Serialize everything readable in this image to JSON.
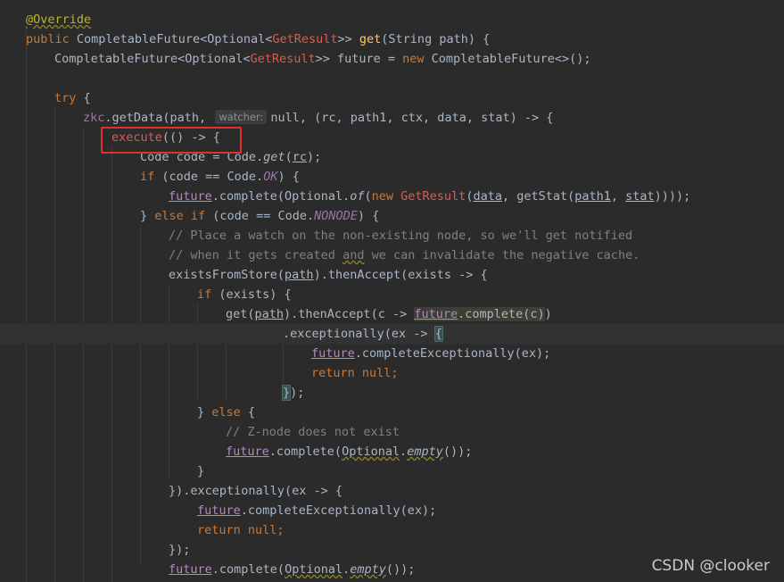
{
  "editor": {
    "hint_label": "watcher:",
    "lines": {
      "l1": {
        "ann": "@Override"
      },
      "l2": {
        "a": "public",
        "b": " CompletableFuture<Optional<",
        "c": "GetResult",
        ">": ">> ",
        "d": "get",
        "e": "(String path) {"
      },
      "l3": {
        "a": "CompletableFuture<Optional<",
        "b": "GetResult",
        "c": ">> future = ",
        "d": "new",
        "e": " CompletableFuture<>();"
      },
      "l5": {
        "a": "try",
        "b": " {"
      },
      "l6": {
        "a": "zkc",
        "b": ".getData(path, ",
        "c": "null, (rc, path1, ctx, data, stat) -> ",
        "d": "{"
      },
      "l7": {
        "a": "execute",
        "b": "(() -> {"
      },
      "l8": {
        "a": "Code code = Code.",
        "b": "get",
        "c": "(",
        "d": "rc",
        "e": ");"
      },
      "l9": {
        "a": "if",
        "b": " (code == Code.",
        "c": "OK",
        "d": ") {"
      },
      "l10": {
        "a": "future",
        "b": ".complete(Optional.",
        "c": "of",
        "d": "(",
        "e": "new",
        "f": " ",
        "g": "GetResult",
        "h": "(",
        "i": "data",
        "j": ", getStat(",
        "k": "path1",
        ",": ", ",
        "l": "stat",
        "m": "))));"
      },
      "l11": {
        "a": "} ",
        "b": "else if",
        "c": " (code == Code.",
        "d": "NONODE",
        "e": ") {"
      },
      "l12": {
        "a": "// Place a watch on the non-existing node, so we'll get notified"
      },
      "l13": {
        "a": "// when it gets created ",
        "b": "and",
        "c": " we can invalidate the negative cache."
      },
      "l14": {
        "a": "existsFromStore(",
        "b": "path",
        "c": ").thenAccept(exists -> {"
      },
      "l15": {
        "a": "if",
        "b": " (exists) {"
      },
      "l16": {
        "a": "get(",
        "b": "path",
        "c": ").thenAccept(c -> ",
        "d": "future",
        "e": ".complete(c)",
        "f": ")"
      },
      "l17": {
        "a": ".exceptionally(ex -> ",
        "b": "{"
      },
      "l18": {
        "a": "future",
        "b": ".completeExceptionally(ex);"
      },
      "l19": {
        "a": "return",
        "b": " null;"
      },
      "l20": {
        "a": "}",
        "b": ");"
      },
      "l21": {
        "a": "} ",
        "b": "else",
        "c": " {"
      },
      "l22": {
        "a": "// Z-node does not exist"
      },
      "l23": {
        "a": "future",
        "b": ".complete(",
        "c": "Optional",
        "d": ".",
        "e": "empty",
        "f": "());"
      },
      "l24": {
        "a": "}"
      },
      "l25": {
        "a": "}).exceptionally(ex -> {"
      },
      "l26": {
        "a": "future",
        "b": ".completeExceptionally(ex);"
      },
      "l27": {
        "a": "return",
        "b": " null;"
      },
      "l28": {
        "a": "});"
      },
      "l29": {
        "a": "future",
        "b": ".complete(",
        "c": "Optional",
        ".": ".",
        "e": "empty",
        "f": "());"
      }
    }
  },
  "watermark": "CSDN @clooker",
  "colors": {
    "background": "#2b2b2b",
    "keyword": "#cc7832",
    "function": "#ffc66d",
    "comment": "#808080",
    "field": "#9876aa",
    "annotation": "#bbb529",
    "error": "#e05a4f",
    "highlight_box": "#e0322a"
  }
}
